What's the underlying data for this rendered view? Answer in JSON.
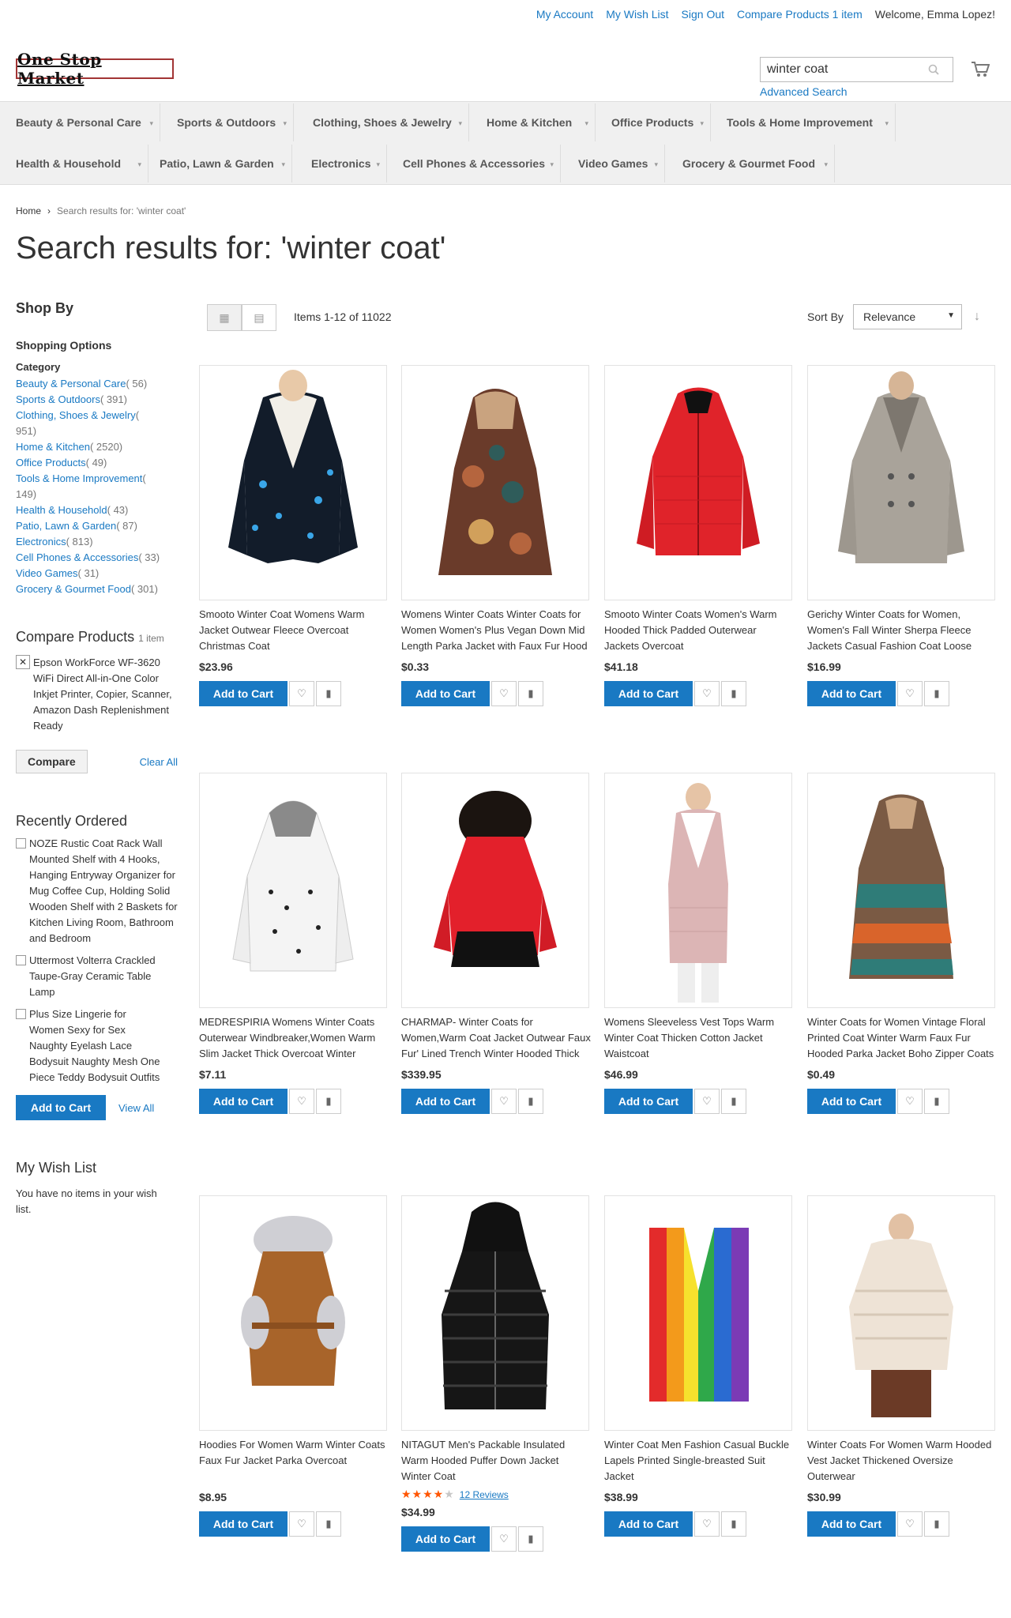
{
  "header": {
    "links": [
      "My Account",
      "My Wish List",
      "Sign Out",
      "Compare Products"
    ],
    "compare_count": "1 item",
    "welcome": "Welcome, Emma Lopez!",
    "logo_text": "One Stop Market",
    "search_value": "winter coat",
    "advanced_search": "Advanced Search"
  },
  "nav": {
    "row1": [
      "Beauty & Personal Care",
      "Sports & Outdoors",
      "Clothing, Shoes & Jewelry",
      "Home & Kitchen",
      "Office Products",
      "Tools & Home Improvement"
    ],
    "row2": [
      "Health & Household",
      "Patio, Lawn & Garden",
      "Electronics",
      "Cell Phones & Accessories",
      "Video Games",
      "Grocery & Gourmet Food"
    ]
  },
  "breadcrumb": {
    "home": "Home",
    "separator": "›",
    "current": "Search results for: 'winter coat'"
  },
  "page_title": "Search results for: 'winter coat'",
  "toolbar": {
    "amount": "Items 1-12 of 11022",
    "sort_label": "Sort By",
    "sort_value": "Relevance"
  },
  "sidebar": {
    "shop_by": "Shop By",
    "shopping_options": "Shopping Options",
    "category_title": "Category",
    "categories": [
      {
        "name": "Beauty & Personal Care",
        "count": "( 56)"
      },
      {
        "name": "Sports & Outdoors",
        "count": "( 391)"
      },
      {
        "name": "Clothing, Shoes & Jewelry",
        "count": "( 951)"
      },
      {
        "name": "Home & Kitchen",
        "count": "( 2520)"
      },
      {
        "name": "Office Products",
        "count": "( 49)"
      },
      {
        "name": "Tools & Home Improvement",
        "count": "( 149)"
      },
      {
        "name": "Health & Household",
        "count": "( 43)"
      },
      {
        "name": "Patio, Lawn & Garden",
        "count": "( 87)"
      },
      {
        "name": "Electronics",
        "count": "( 813)"
      },
      {
        "name": "Cell Phones & Accessories",
        "count": "( 33)"
      },
      {
        "name": "Video Games",
        "count": "( 31)"
      },
      {
        "name": "Grocery & Gourmet Food",
        "count": "( 301)"
      }
    ],
    "compare_title": "Compare Products",
    "compare_count": "1 item",
    "compare_item": "Epson WorkForce WF-3620 WiFi Direct All-in-One Color Inkjet Printer, Copier, Scanner, Amazon Dash Replenishment Ready",
    "compare_button": "Compare",
    "clear_all": "Clear All",
    "recent_title": "Recently Ordered",
    "recent_items": [
      "NOZE Rustic Coat Rack Wall Mounted Shelf with 4 Hooks, Hanging Entryway Organizer for Mug Coffee Cup, Holding Solid Wooden Shelf with 2 Baskets for Kitchen Living Room, Bathroom and Bedroom",
      "Uttermost Volterra Crackled Taupe-Gray Ceramic Table Lamp",
      "Plus Size Lingerie for Women Sexy for Sex Naughty Eyelash Lace Bodysuit Naughty Mesh One Piece Teddy Bodysuit Outfits"
    ],
    "add_to_cart": "Add to Cart",
    "view_all": "View All",
    "wishlist_title": "My Wish List",
    "wishlist_empty": "You have no items in your wish list."
  },
  "product_labels": {
    "add_to_cart": "Add to Cart"
  },
  "products": [
    {
      "name": "Smooto Winter Coat Womens Warm Jacket Outwear Fleece Overcoat Christmas Coat",
      "price": "$23.96"
    },
    {
      "name": "Womens Winter Coats Winter Coats for Women Women's Plus Vegan Down Mid Length Parka Jacket with Faux Fur Hood",
      "price": "$0.33"
    },
    {
      "name": "Smooto Winter Coats Women's Warm Hooded Thick Padded Outerwear Jackets Overcoat",
      "price": "$41.18"
    },
    {
      "name": "Gerichy Winter Coats for Women, Women's Fall Winter Sherpa Fleece Jackets Casual Fashion Coat Loose Long Sleeve Outwear",
      "price": "$16.99"
    },
    {
      "name": "MEDRESPIRIA Womens Winter Coats Outerwear Windbreaker,Women Warm Slim Jacket Thick Overcoat Winter Outwear Hooded Zipper Coat",
      "price": "$7.11"
    },
    {
      "name": "CHARMAP- Winter Coats for Women,Warm Coat Jacket Outwear Faux Fur' Lined Trench Winter Hooded Thick Overcoat",
      "price": "$339.95"
    },
    {
      "name": "Womens Sleeveless Vest Tops Warm Winter Coat Thicken Cotton Jacket Waistcoat",
      "price": "$46.99"
    },
    {
      "name": "Winter Coats for Women Vintage Floral Printed Coat Winter Warm Faux Fur Hooded Parka Jacket Boho Zipper Coats Outwear",
      "price": "$0.49"
    },
    {
      "name": "Hoodies For Women Warm Winter Coats Faux Fur Jacket Parka Overcoat",
      "price": "$8.95"
    },
    {
      "name": "NITAGUT Men's Packable Insulated Warm Hooded Puffer Down Jacket Winter Coat",
      "price": "$34.99",
      "rating": 4,
      "reviews": "12  Reviews"
    },
    {
      "name": "Winter Coat Men Fashion Casual Buckle Lapels Printed Single-breasted Suit Jacket",
      "price": "$38.99"
    },
    {
      "name": "Winter Coats For Women Warm Hooded Vest Jacket Thickened Oversize Outerwear",
      "price": "$30.99"
    }
  ]
}
